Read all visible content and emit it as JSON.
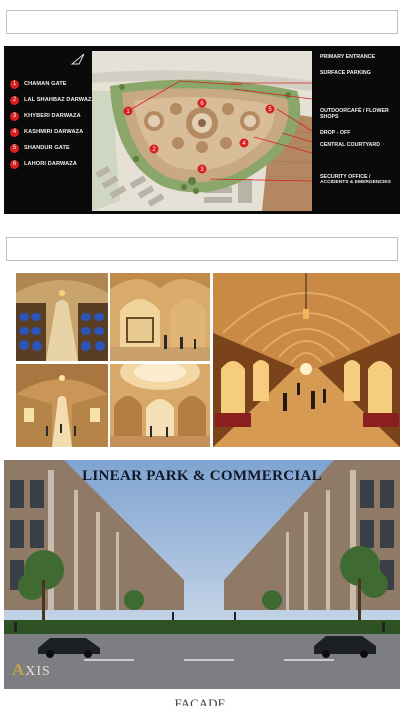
{
  "site_plan": {
    "legend": [
      {
        "num": "1",
        "label": "CHAMAN GATE"
      },
      {
        "num": "2",
        "label": "LAL SHAHBAZ DARWAZA"
      },
      {
        "num": "3",
        "label": "KHYBERI DARWAZA"
      },
      {
        "num": "4",
        "label": "KASHMIRI DARWAZA"
      },
      {
        "num": "5",
        "label": "SHANDUR GATE"
      },
      {
        "num": "6",
        "label": "LAHORI DARWAZA"
      }
    ],
    "callouts": {
      "primary_entrance": "PRIMARY ENTRANCE",
      "surface_parking": "SURFACE PARKING",
      "outdoor_cafe_1": "OUTDOORCAFÉ / FLOWER",
      "outdoor_cafe_2": "SHOPS",
      "drop_off": "DROP - OFF",
      "central_courtyard": "CENTRAL COURTYARD",
      "security_1": "SECURITY OFFICE /",
      "security_2": "ACCIDENTS & EMERGENCIES"
    },
    "gate_markers": [
      "1",
      "6",
      "2",
      "5",
      "4",
      "3"
    ]
  },
  "park": {
    "title": "LINEAR PARK & COMMERCIAL",
    "logo_a": "A",
    "logo_rest": "XIS"
  },
  "next_section": {
    "title": "FACADE"
  },
  "colors": {
    "marker_red": "#d8201e",
    "plan_bg": "#0a0a0a"
  },
  "icons": {
    "north_arrow": "north-arrow-icon"
  }
}
